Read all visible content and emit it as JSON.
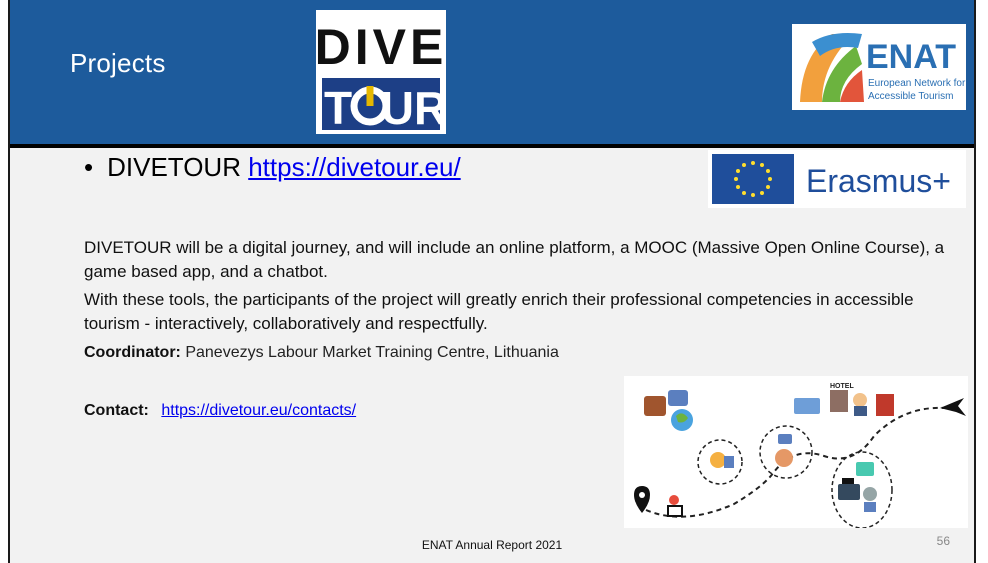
{
  "header": {
    "title": "Projects",
    "dive_logo": {
      "line1": "DIVE",
      "line2_a": "T",
      "line2_b": "UR"
    },
    "enat_logo": {
      "word": "ENAT",
      "subtitle_line1": "European Network for",
      "subtitle_line2": "Accessible Tourism"
    }
  },
  "bullet": {
    "marker": "•",
    "label": "DIVETOUR",
    "link_text": "https://divetour.eu/"
  },
  "erasmus_logo": {
    "text": "Erasmus+"
  },
  "body": {
    "paragraph1": "DIVETOUR will be a digital journey, and will include an online platform, a MOOC (Massive Open Online Course), a game based app, and a chatbot.",
    "paragraph2": "With these tools, the participants of the project will greatly enrich their professional competencies in accessible tourism - interactively, collaboratively and respectfully."
  },
  "coordinator": {
    "label": "Coordinator:",
    "value": "Panevezys Labour Market Training Centre, Lithuania"
  },
  "contact": {
    "label": "Contact:",
    "link_text": "https://divetour.eu/contacts/"
  },
  "illustration": {
    "hotel_sign": "HOTEL"
  },
  "footer": {
    "text": "ENAT Annual Report 2021",
    "page_number": "56"
  },
  "colors": {
    "header_bg": "#1d5b9c",
    "slide_bg": "#f2f2f2",
    "link": "#0000ee",
    "enat_blue": "#2a6fb3",
    "eu_blue": "#1f4e9b"
  }
}
